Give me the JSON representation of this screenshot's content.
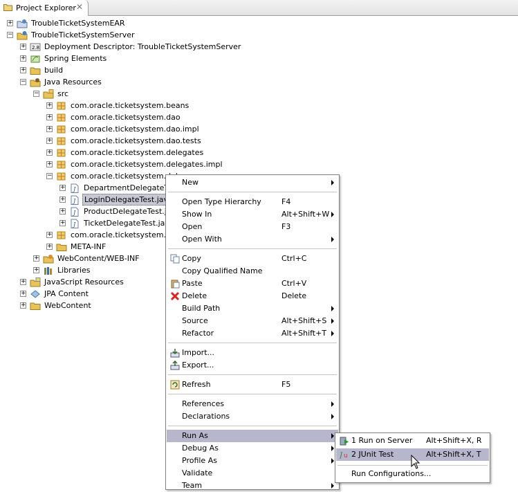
{
  "view": {
    "title": "Project Explorer",
    "close_glyph": "✕"
  },
  "tree": [
    {
      "label": "TroubleTicketSystemEAR",
      "icon": "ear-project-icon",
      "twist": "+",
      "depth": 0
    },
    {
      "label": "TroubleTicketSystemServer",
      "icon": "web-project-icon",
      "twist": "−",
      "depth": 0
    },
    {
      "label": "Deployment Descriptor: TroubleTicketSystemServer",
      "icon": "deployment-descriptor-icon",
      "twist": "+",
      "depth": 1
    },
    {
      "label": "Spring Elements",
      "icon": "spring-elements-icon",
      "twist": "+",
      "depth": 1
    },
    {
      "label": "build",
      "icon": "folder-icon",
      "twist": "+",
      "depth": 1
    },
    {
      "label": "Java Resources",
      "icon": "java-resources-icon",
      "twist": "−",
      "depth": 1
    },
    {
      "label": "src",
      "icon": "source-folder-icon",
      "twist": "−",
      "depth": 2
    },
    {
      "label": "com.oracle.ticketsystem.beans",
      "icon": "package-icon",
      "twist": "+",
      "depth": 3
    },
    {
      "label": "com.oracle.ticketsystem.dao",
      "icon": "package-icon",
      "twist": "+",
      "depth": 3
    },
    {
      "label": "com.oracle.ticketsystem.dao.impl",
      "icon": "package-icon",
      "twist": "+",
      "depth": 3
    },
    {
      "label": "com.oracle.ticketsystem.dao.tests",
      "icon": "package-icon",
      "twist": "+",
      "depth": 3
    },
    {
      "label": "com.oracle.ticketsystem.delegates",
      "icon": "package-icon",
      "twist": "+",
      "depth": 3
    },
    {
      "label": "com.oracle.ticketsystem.delegates.impl",
      "icon": "package-icon",
      "twist": "+",
      "depth": 3
    },
    {
      "label": "com.oracle.ticketsystem.dele",
      "icon": "package-icon",
      "twist": "−",
      "depth": 3
    },
    {
      "label": "DepartmentDelegateTes",
      "icon": "java-file-icon",
      "twist": "+",
      "depth": 4
    },
    {
      "label": "LoginDelegateTest.java",
      "icon": "java-file-icon",
      "twist": "+",
      "depth": 4,
      "selected": true
    },
    {
      "label": "ProductDelegateTest.jav",
      "icon": "java-file-icon",
      "twist": "+",
      "depth": 4
    },
    {
      "label": "TicketDelegateTest.java",
      "icon": "java-file-icon",
      "twist": "+",
      "depth": 4
    },
    {
      "label": "com.oracle.ticketsystem.util",
      "icon": "package-icon",
      "twist": "+",
      "depth": 3
    },
    {
      "label": "META-INF",
      "icon": "folder-icon",
      "twist": "+",
      "depth": 3
    },
    {
      "label": "WebContent/WEB-INF",
      "icon": "web-inf-icon",
      "twist": "+",
      "depth": 2
    },
    {
      "label": "Libraries",
      "icon": "libraries-icon",
      "twist": "+",
      "depth": 2
    },
    {
      "label": "JavaScript Resources",
      "icon": "javascript-resources-icon",
      "twist": "+",
      "depth": 1
    },
    {
      "label": "JPA Content",
      "icon": "jpa-content-icon",
      "twist": "+",
      "depth": 1
    },
    {
      "label": "WebContent",
      "icon": "webcontent-folder-icon",
      "twist": "+",
      "depth": 1
    }
  ],
  "context_menu": {
    "items": [
      {
        "label": "New",
        "key": "",
        "submenu": true,
        "icon": ""
      },
      {
        "sep": true
      },
      {
        "label": "Open Type Hierarchy",
        "key": "F4",
        "submenu": false,
        "icon": ""
      },
      {
        "label": "Show In",
        "key": "Alt+Shift+W",
        "submenu": true,
        "icon": ""
      },
      {
        "label": "Open",
        "key": "F3",
        "submenu": false,
        "icon": ""
      },
      {
        "label": "Open With",
        "key": "",
        "submenu": true,
        "icon": ""
      },
      {
        "sep": true
      },
      {
        "label": "Copy",
        "key": "Ctrl+C",
        "submenu": false,
        "icon": "copy-icon"
      },
      {
        "label": "Copy Qualified Name",
        "key": "",
        "submenu": false,
        "icon": ""
      },
      {
        "label": "Paste",
        "key": "Ctrl+V",
        "submenu": false,
        "icon": "paste-icon"
      },
      {
        "label": "Delete",
        "key": "Delete",
        "submenu": false,
        "icon": "delete-icon"
      },
      {
        "label": "Build Path",
        "key": "",
        "submenu": true,
        "icon": ""
      },
      {
        "label": "Source",
        "key": "Alt+Shift+S",
        "submenu": true,
        "icon": ""
      },
      {
        "label": "Refactor",
        "key": "Alt+Shift+T",
        "submenu": true,
        "icon": ""
      },
      {
        "sep": true
      },
      {
        "label": "Import...",
        "key": "",
        "submenu": false,
        "icon": "import-icon"
      },
      {
        "label": "Export...",
        "key": "",
        "submenu": false,
        "icon": "export-icon"
      },
      {
        "sep": true
      },
      {
        "label": "Refresh",
        "key": "F5",
        "submenu": false,
        "icon": "refresh-icon"
      },
      {
        "sep": true
      },
      {
        "label": "References",
        "key": "",
        "submenu": true,
        "icon": ""
      },
      {
        "label": "Declarations",
        "key": "",
        "submenu": true,
        "icon": ""
      },
      {
        "sep": true
      },
      {
        "label": "Run As",
        "key": "",
        "submenu": true,
        "icon": "",
        "highlighted": true
      },
      {
        "label": "Debug As",
        "key": "",
        "submenu": true,
        "icon": ""
      },
      {
        "label": "Profile As",
        "key": "",
        "submenu": true,
        "icon": ""
      },
      {
        "label": "Validate",
        "key": "",
        "submenu": false,
        "icon": ""
      },
      {
        "label": "Team",
        "key": "",
        "submenu": true,
        "icon": ""
      }
    ]
  },
  "run_as_menu": {
    "items": [
      {
        "label": "1 Run on Server",
        "key": "Alt+Shift+X, R",
        "icon": "run-on-server-icon"
      },
      {
        "label": "2 JUnit Test",
        "key": "Alt+Shift+X, T",
        "icon": "junit-icon",
        "highlighted": true
      },
      {
        "sep": true
      },
      {
        "label": "Run Configurations...",
        "key": "",
        "icon": ""
      }
    ]
  },
  "colors": {
    "menu_highlight": "#b6b6cc",
    "selection": "#c8c8d4",
    "package": "#b8860b",
    "folder": "#e8c35a"
  }
}
